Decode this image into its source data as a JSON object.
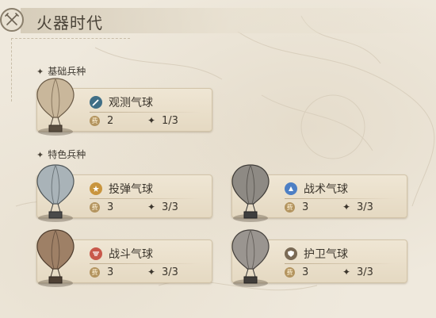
{
  "header": {
    "title": "火器时代",
    "emblem_icon": "crossed-muskets-icon"
  },
  "sections": {
    "basic": {
      "label": "基础兵种"
    },
    "special": {
      "label": "特色兵种"
    }
  },
  "cost_icon_char": "费",
  "units": [
    {
      "name": "观测气球",
      "cost": "2",
      "limit": "1/3",
      "icon": "spyglass-icon",
      "icon_color": "#3f6e86",
      "balloon_color": "#c9b79b"
    },
    {
      "name": "投弹气球",
      "cost": "3",
      "limit": "3/3",
      "icon": "bomb-burst-icon",
      "icon_color": "#c9953e",
      "balloon_color": "#a9b3b8"
    },
    {
      "name": "战术气球",
      "cost": "3",
      "limit": "3/3",
      "icon": "tactics-icon",
      "icon_color": "#4d7fc4",
      "balloon_color": "#8e8a84"
    },
    {
      "name": "战斗气球",
      "cost": "3",
      "limit": "3/3",
      "icon": "wings-icon",
      "icon_color": "#c8584b",
      "balloon_color": "#9e8066"
    },
    {
      "name": "护卫气球",
      "cost": "3",
      "limit": "3/3",
      "icon": "shield-icon",
      "icon_color": "#7a6a55",
      "balloon_color": "#9a9590"
    }
  ]
}
